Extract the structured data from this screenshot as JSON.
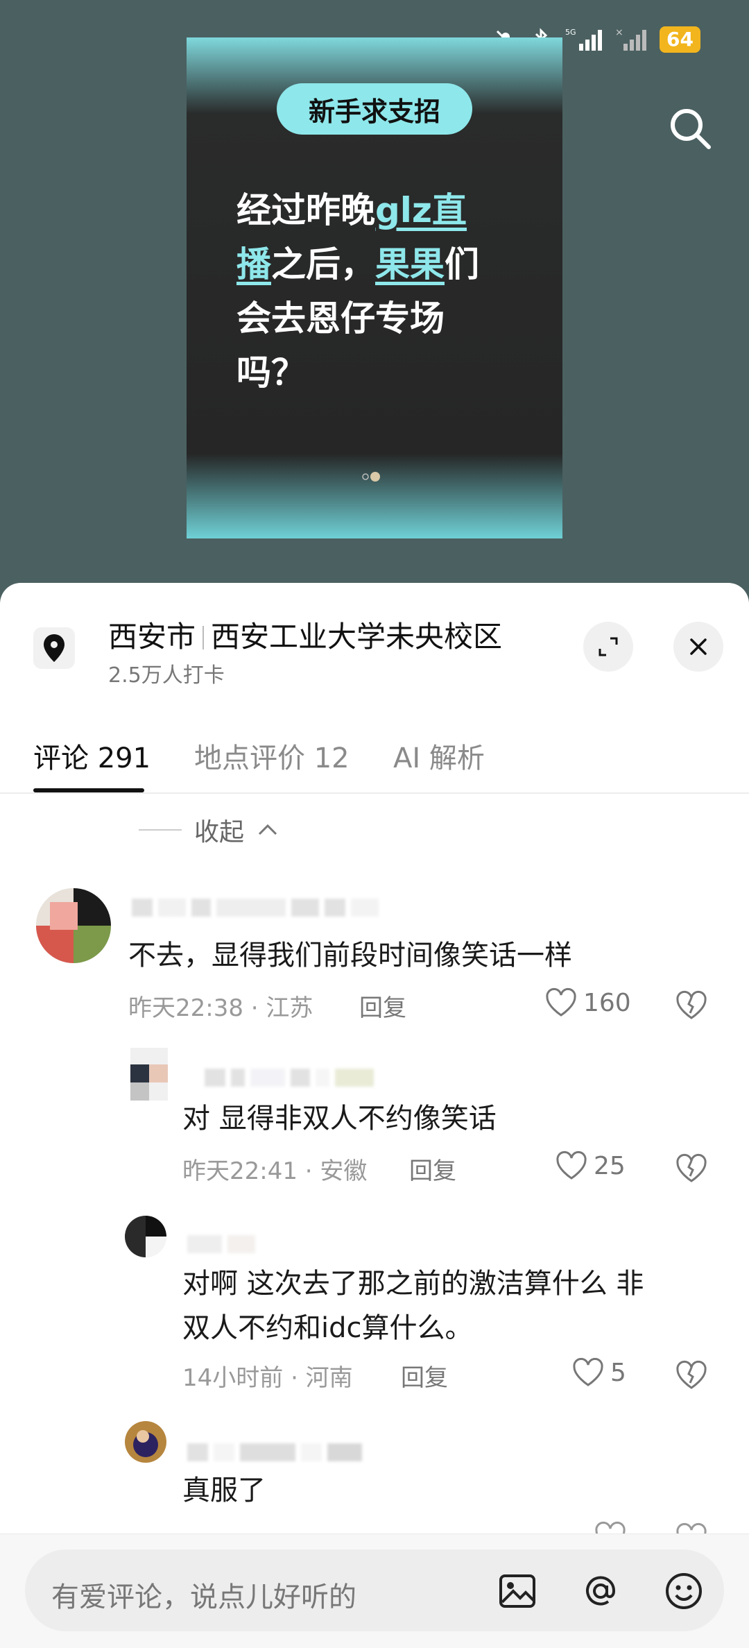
{
  "status": {
    "battery": "64",
    "network": "5G"
  },
  "poster": {
    "badge": "新手求支招",
    "line1a": "经过昨晚",
    "line1b": "glz直",
    "line2a": "播",
    "line2b": "之后，",
    "line2c": "果果",
    "line2d": "们",
    "line3": "会去恩仔专场",
    "line4": "吗？"
  },
  "location": {
    "city": "西安市",
    "place": "西安工业大学未央校区",
    "checkins": "2.5万人打卡"
  },
  "tabs": [
    {
      "label": "评论 291"
    },
    {
      "label": "地点评价 12"
    },
    {
      "label": "AI 解析"
    }
  ],
  "collapse_label": "收起",
  "comments": [
    {
      "text": "不去，显得我们前段时间像笑话一样",
      "meta": "昨天22:38 · 江苏",
      "reply": "回复",
      "likes": "160"
    },
    {
      "text": "对 显得非双人不约像笑话",
      "meta": "昨天22:41 · 安徽",
      "reply": "回复",
      "likes": "25"
    },
    {
      "text1": "对啊 这次去了那之前的激洁算什么 非",
      "text2": "双人不约和idc算什么。",
      "meta": "14小时前 · 河南",
      "reply": "回复",
      "likes": "5"
    },
    {
      "text": "真服了"
    }
  ],
  "input": {
    "placeholder": "有爱评论，说点儿好听的"
  },
  "colors": {
    "accent": "#8ee7ea",
    "battery": "#f2b51d",
    "background": "#4b6061"
  }
}
